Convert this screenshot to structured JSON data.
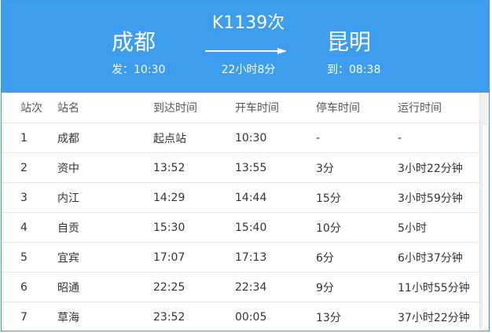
{
  "header": {
    "from_station": "成都",
    "depart_time": "发：10:30",
    "train_number": "K1139次",
    "duration": "22小时8分",
    "to_station": "昆明",
    "arrive_time": "到：08:38"
  },
  "table": {
    "columns": [
      "站次",
      "站名",
      "到达时间",
      "开车时间",
      "停车时间",
      "运行时间"
    ],
    "rows": [
      [
        "1",
        "成都",
        "起点站",
        "10:30",
        "-",
        "-"
      ],
      [
        "2",
        "资中",
        "13:52",
        "13:55",
        "3分",
        "3小时22分钟"
      ],
      [
        "3",
        "内江",
        "14:29",
        "14:44",
        "15分",
        "3小时59分钟"
      ],
      [
        "4",
        "自贡",
        "15:30",
        "15:40",
        "10分",
        "5小时"
      ],
      [
        "5",
        "宜宾",
        "17:07",
        "17:13",
        "6分",
        "6小时37分钟"
      ],
      [
        "6",
        "昭通",
        "22:25",
        "22:34",
        "9分",
        "11小时55分钟"
      ],
      [
        "7",
        "草海",
        "23:52",
        "00:05",
        "13分",
        "37小时22分钟"
      ]
    ]
  },
  "colors": {
    "header_bg": "#3d9ef0",
    "border": "#3399ee"
  },
  "icons": {
    "route_arrow": "arrow-right-icon"
  }
}
